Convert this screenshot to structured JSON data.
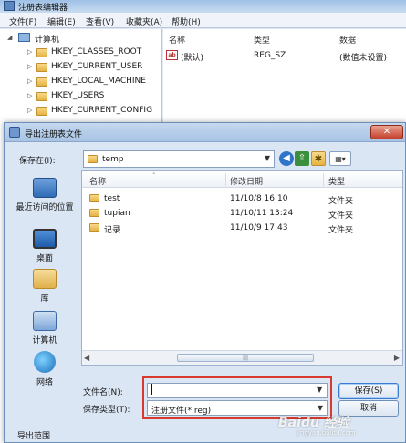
{
  "registry": {
    "title": "注册表编辑器",
    "menu": [
      "文件(F)",
      "编辑(E)",
      "查看(V)",
      "收藏夹(A)",
      "帮助(H)"
    ],
    "tree": {
      "root": "计算机",
      "keys": [
        "HKEY_CLASSES_ROOT",
        "HKEY_CURRENT_USER",
        "HKEY_LOCAL_MACHINE",
        "HKEY_USERS",
        "HKEY_CURRENT_CONFIG"
      ]
    },
    "columns": [
      "名称",
      "类型",
      "数据"
    ],
    "value": {
      "icon_text": "ab",
      "name": "(默认)",
      "type": "REG_SZ",
      "data": "(数值未设置)"
    }
  },
  "dialog": {
    "title": "导出注册表文件",
    "close_label": "✕",
    "save_in_label": "保存在(I):",
    "location": "temp",
    "places": [
      "最近访问的位置",
      "桌面",
      "库",
      "计算机",
      "网络"
    ],
    "columns": [
      "名称",
      "修改日期",
      "类型"
    ],
    "files": [
      {
        "name": "test",
        "modified": "11/10/8 16:10",
        "type": "文件夹"
      },
      {
        "name": "tupian",
        "modified": "11/10/11 13:24",
        "type": "文件夹"
      },
      {
        "name": "记录",
        "modified": "11/10/9 17:43",
        "type": "文件夹"
      }
    ],
    "filename_label": "文件名(N):",
    "filename_value": "",
    "filetype_label": "保存类型(T):",
    "filetype_value": "注册文件(*.reg)",
    "save_button": "保存(S)",
    "cancel_button": "取消",
    "export_range_label": "导出范围"
  },
  "watermark": {
    "brand": "Baidu 经验",
    "url": "jingyan.baidu.com"
  },
  "colors": {
    "highlight": "#d83a2e",
    "close": "#c4402b"
  }
}
